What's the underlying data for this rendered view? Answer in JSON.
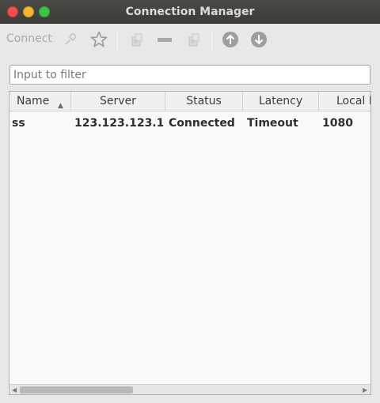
{
  "window": {
    "title": "Connection Manager"
  },
  "toolbar": {
    "connect_label": "Connect",
    "icons": [
      "connect-plug-icon",
      "star-icon",
      "copy-icon",
      "remove-icon",
      "paste-icon",
      "move-up-icon",
      "move-down-icon"
    ]
  },
  "filter": {
    "placeholder": "Input to filter",
    "value": ""
  },
  "table": {
    "columns": [
      "Name",
      "Server",
      "Status",
      "Latency",
      "Local Port"
    ],
    "sorted_column": "Name",
    "sort_direction": "ascending",
    "rows": [
      {
        "name": "ss",
        "server": "123.123.123.1...",
        "status": "Connected",
        "latency": "Timeout",
        "local_port": "1080"
      }
    ]
  },
  "colors": {
    "titlebar": "#3c3b37",
    "close": "#ee4f4f",
    "minimize": "#f5b730",
    "maximize": "#3fc24a"
  }
}
